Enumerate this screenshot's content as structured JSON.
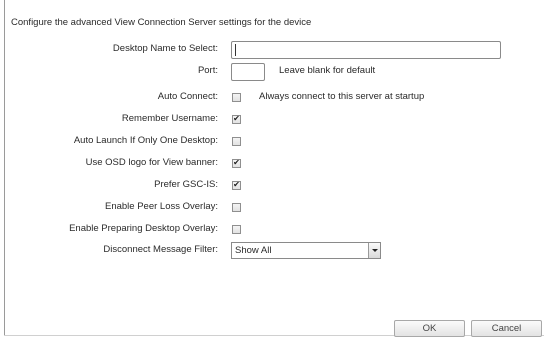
{
  "intro": "Configure the advanced View Connection Server settings for the device",
  "desktop_name": {
    "label": "Desktop Name to Select:",
    "value": ""
  },
  "port": {
    "label": "Port:",
    "value": "",
    "hint": "Leave blank for default"
  },
  "auto_connect": {
    "label": "Auto Connect:",
    "checked": false,
    "hint": "Always connect to this server at startup"
  },
  "checkboxes": [
    {
      "label": "Remember Username:",
      "checked": true
    },
    {
      "label": "Auto Launch If Only One Desktop:",
      "checked": false
    },
    {
      "label": "Use OSD logo for View banner:",
      "checked": true
    },
    {
      "label": "Prefer GSC-IS:",
      "checked": true
    },
    {
      "label": "Enable Peer Loss Overlay:",
      "checked": false
    },
    {
      "label": "Enable Preparing Desktop Overlay:",
      "checked": false
    }
  ],
  "disconnect_filter": {
    "label": "Disconnect Message Filter:",
    "selected": "Show All"
  },
  "buttons": {
    "ok": "OK",
    "cancel": "Cancel"
  },
  "icons": {
    "checkmark": "checkmark-icon",
    "dropdown": "chevron-down-icon"
  }
}
